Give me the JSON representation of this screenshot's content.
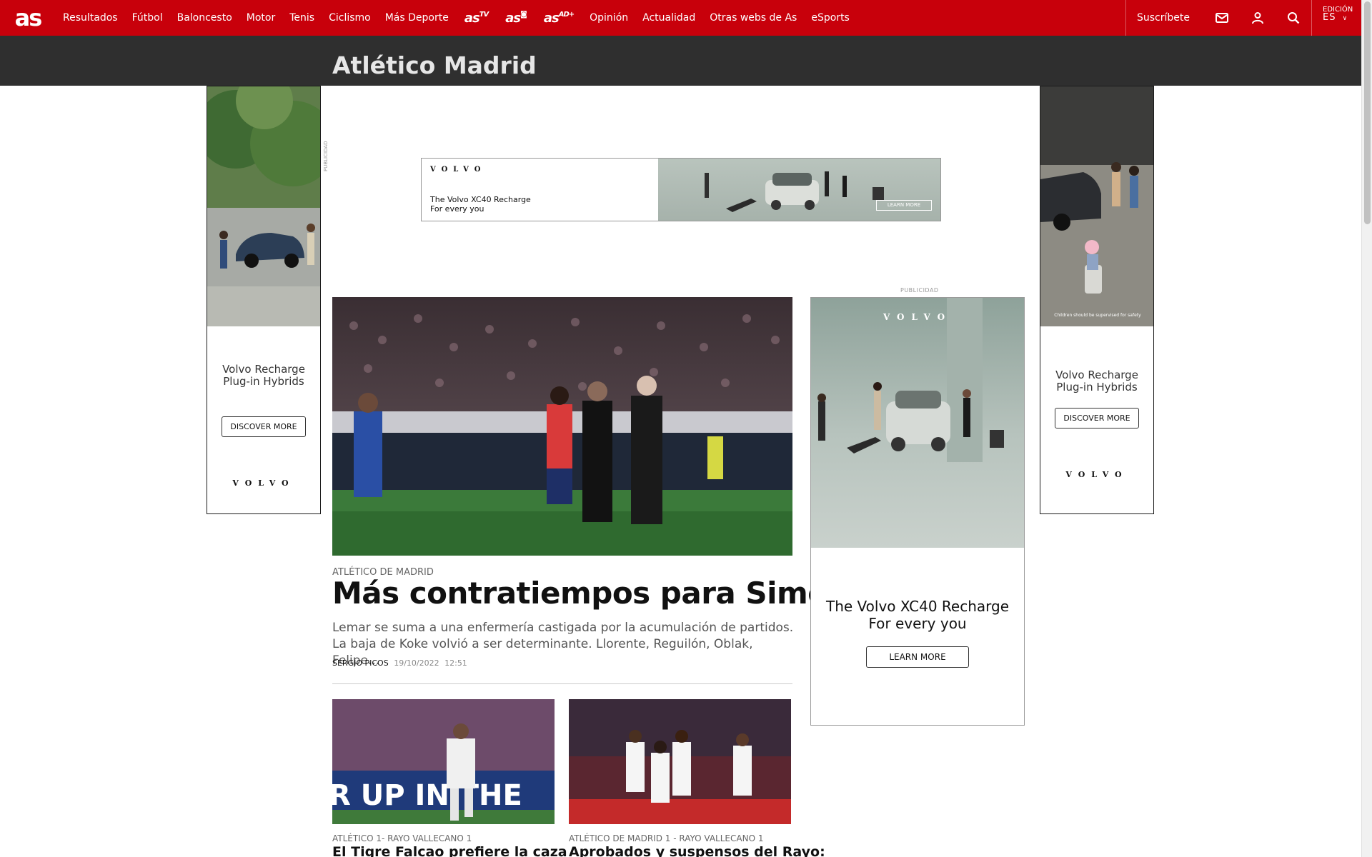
{
  "nav": {
    "logo": "as",
    "items": [
      "Resultados",
      "Fútbol",
      "Baloncesto",
      "Motor",
      "Tenis",
      "Ciclismo",
      "Más Deporte"
    ],
    "brands": [
      "as tv",
      "as foto",
      "as ad+"
    ],
    "items2": [
      "Opinión",
      "Actualidad",
      "Otras webs de As",
      "eSports"
    ],
    "subscribe": "Suscríbete",
    "edition_label": "EDICIÓN",
    "edition_code": "ES",
    "icons": [
      "mail-icon",
      "user-icon",
      "search-icon",
      "chevron-down-icon"
    ]
  },
  "section": {
    "title": "Atlético Madrid"
  },
  "ads": {
    "publicidad": "PUBLICIDAD",
    "skin_left": {
      "copy1": "Volvo Recharge",
      "copy2": "Plug-in Hybrids",
      "button": "DISCOVER MORE",
      "wordmark": "VOLVO"
    },
    "skin_right": {
      "copy1": "Volvo Recharge",
      "copy2": "Plug-in Hybrids",
      "button": "DISCOVER MORE",
      "wordmark": "VOLVO",
      "disclaimer": "Children should be supervised for safety"
    },
    "banner": {
      "wordmark": "VOLVO",
      "line1": "The Volvo XC40 Recharge",
      "line2": "For every you",
      "button": "LEARN MORE"
    },
    "mpu": {
      "wordmark": "VOLVO",
      "line1": "The Volvo XC40 Recharge",
      "line2": "For every you",
      "button": "LEARN MORE"
    }
  },
  "main": {
    "kicker": "ATLÉTICO DE MADRID",
    "headline": "Más contratiempos para Simeone",
    "summary": "Lemar se suma a una enfermería castigada por la acumulación de partidos. La baja de Koke volvió a ser determinante. Llorente, Reguilón, Oblak, Felipe...",
    "author": "SERGIO PICOS",
    "date": "19/10/2022",
    "time": "12:51"
  },
  "cards": [
    {
      "kicker": "ATLÉTICO 1- RAYO VALLECANO 1",
      "title": "El Tigre Falcao prefiere la caza",
      "banner_text": "R UP IN THE"
    },
    {
      "kicker": "ATLÉTICO DE MADRID 1 - RAYO VALLECANO 1",
      "title": "Aprobados y suspensos del Rayo:"
    }
  ],
  "colors": {
    "brand_red": "#c8000b",
    "section_bg": "#2f2f2f"
  }
}
